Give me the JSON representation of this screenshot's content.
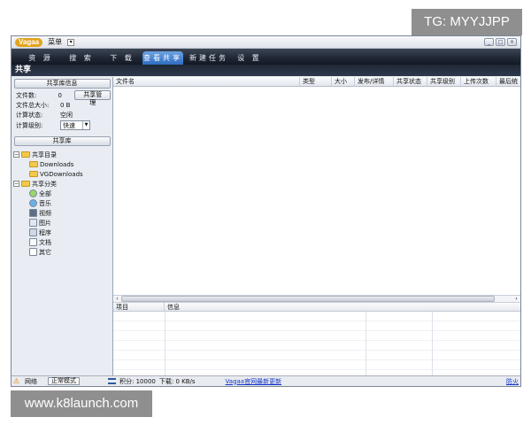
{
  "watermarks": {
    "tag": "TG: MYYJJPP",
    "site": "www.k8launch.com"
  },
  "window": {
    "logo": "Vagaa",
    "menu_label": "菜单",
    "controls": [
      "_",
      "□",
      "×"
    ]
  },
  "nav": {
    "items": [
      "资 源",
      "搜 索",
      "下 载",
      "查看共享",
      "新建任务",
      "设 置"
    ],
    "active_index": 3
  },
  "section_title": "共享",
  "sidebar": {
    "info_title": "共享库信息",
    "file_count_label": "文件数:",
    "file_count_value": "0",
    "share_manage_button": "共享管理",
    "total_size_label": "文件总大小:",
    "total_size_value": "0 B",
    "calc_status_label": "计算状态:",
    "calc_status_value": "空闲",
    "calc_level_label": "计算级别:",
    "calc_level_value": "快速",
    "library_title": "共享库",
    "tree": {
      "dir_label": "共享目录",
      "dirs": [
        "Downloads",
        "VGDownloads"
      ],
      "category_label": "共享分类",
      "categories": [
        "全部",
        "音乐",
        "视频",
        "图片",
        "程序",
        "文档",
        "其它"
      ]
    }
  },
  "table": {
    "columns": [
      "文件名",
      "类型",
      "大小",
      "发布/详情",
      "共享状态",
      "共享级别",
      "上传次数",
      "最后统"
    ]
  },
  "log": {
    "columns": [
      "项目",
      "信息"
    ]
  },
  "status": {
    "network_label": "网络",
    "mode_button": "正常模式",
    "score_text": "积分: 10000",
    "download_text": "下载: 0 KB/s",
    "update_link": "Vagaa官网最新更新",
    "right_link": "防火"
  }
}
